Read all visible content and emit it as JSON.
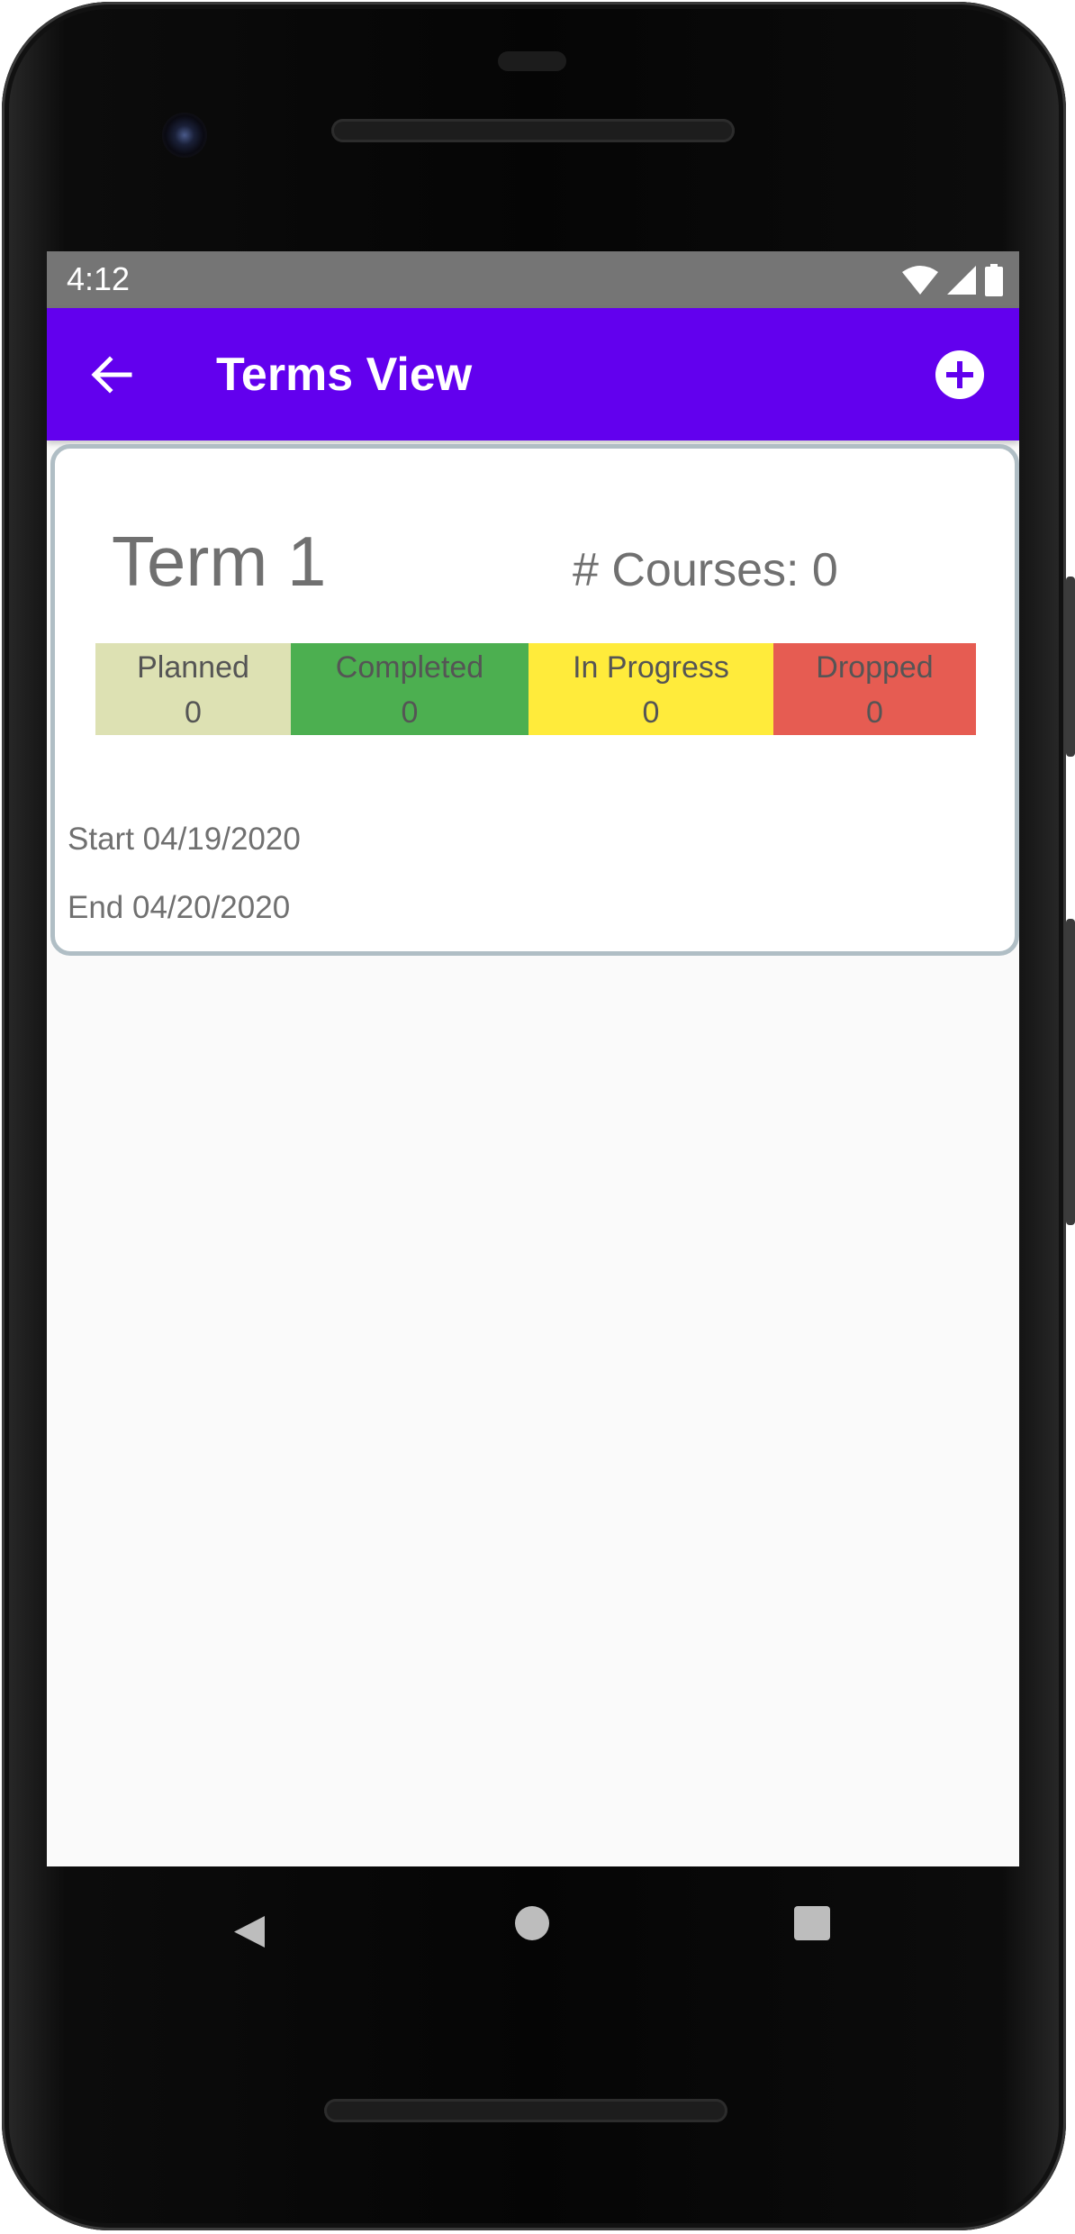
{
  "status_bar": {
    "time": "4:12",
    "background_color": "#757575",
    "icons": [
      "wifi-icon",
      "cellular-signal-icon",
      "battery-icon"
    ]
  },
  "app_bar": {
    "title": "Terms View",
    "background_color": "#6200ee",
    "back_icon": "arrow-back-icon",
    "add_icon": "add-circle-icon"
  },
  "term_card": {
    "title": "Term 1",
    "courses_label": "# Courses: 0",
    "statuses": [
      {
        "label": "Planned",
        "count": "0",
        "color": "#dde1b3"
      },
      {
        "label": "Completed",
        "count": "0",
        "color": "#4caf50"
      },
      {
        "label": "In Progress",
        "count": "0",
        "color": "#ffeb3b"
      },
      {
        "label": "Dropped",
        "count": "0",
        "color": "#e65c52"
      }
    ],
    "start_label": "Start 04/19/2020",
    "end_label": "End 04/20/2020"
  },
  "nav_bar": {
    "icons": [
      "nav-back-icon",
      "nav-home-icon",
      "nav-recents-icon"
    ]
  }
}
